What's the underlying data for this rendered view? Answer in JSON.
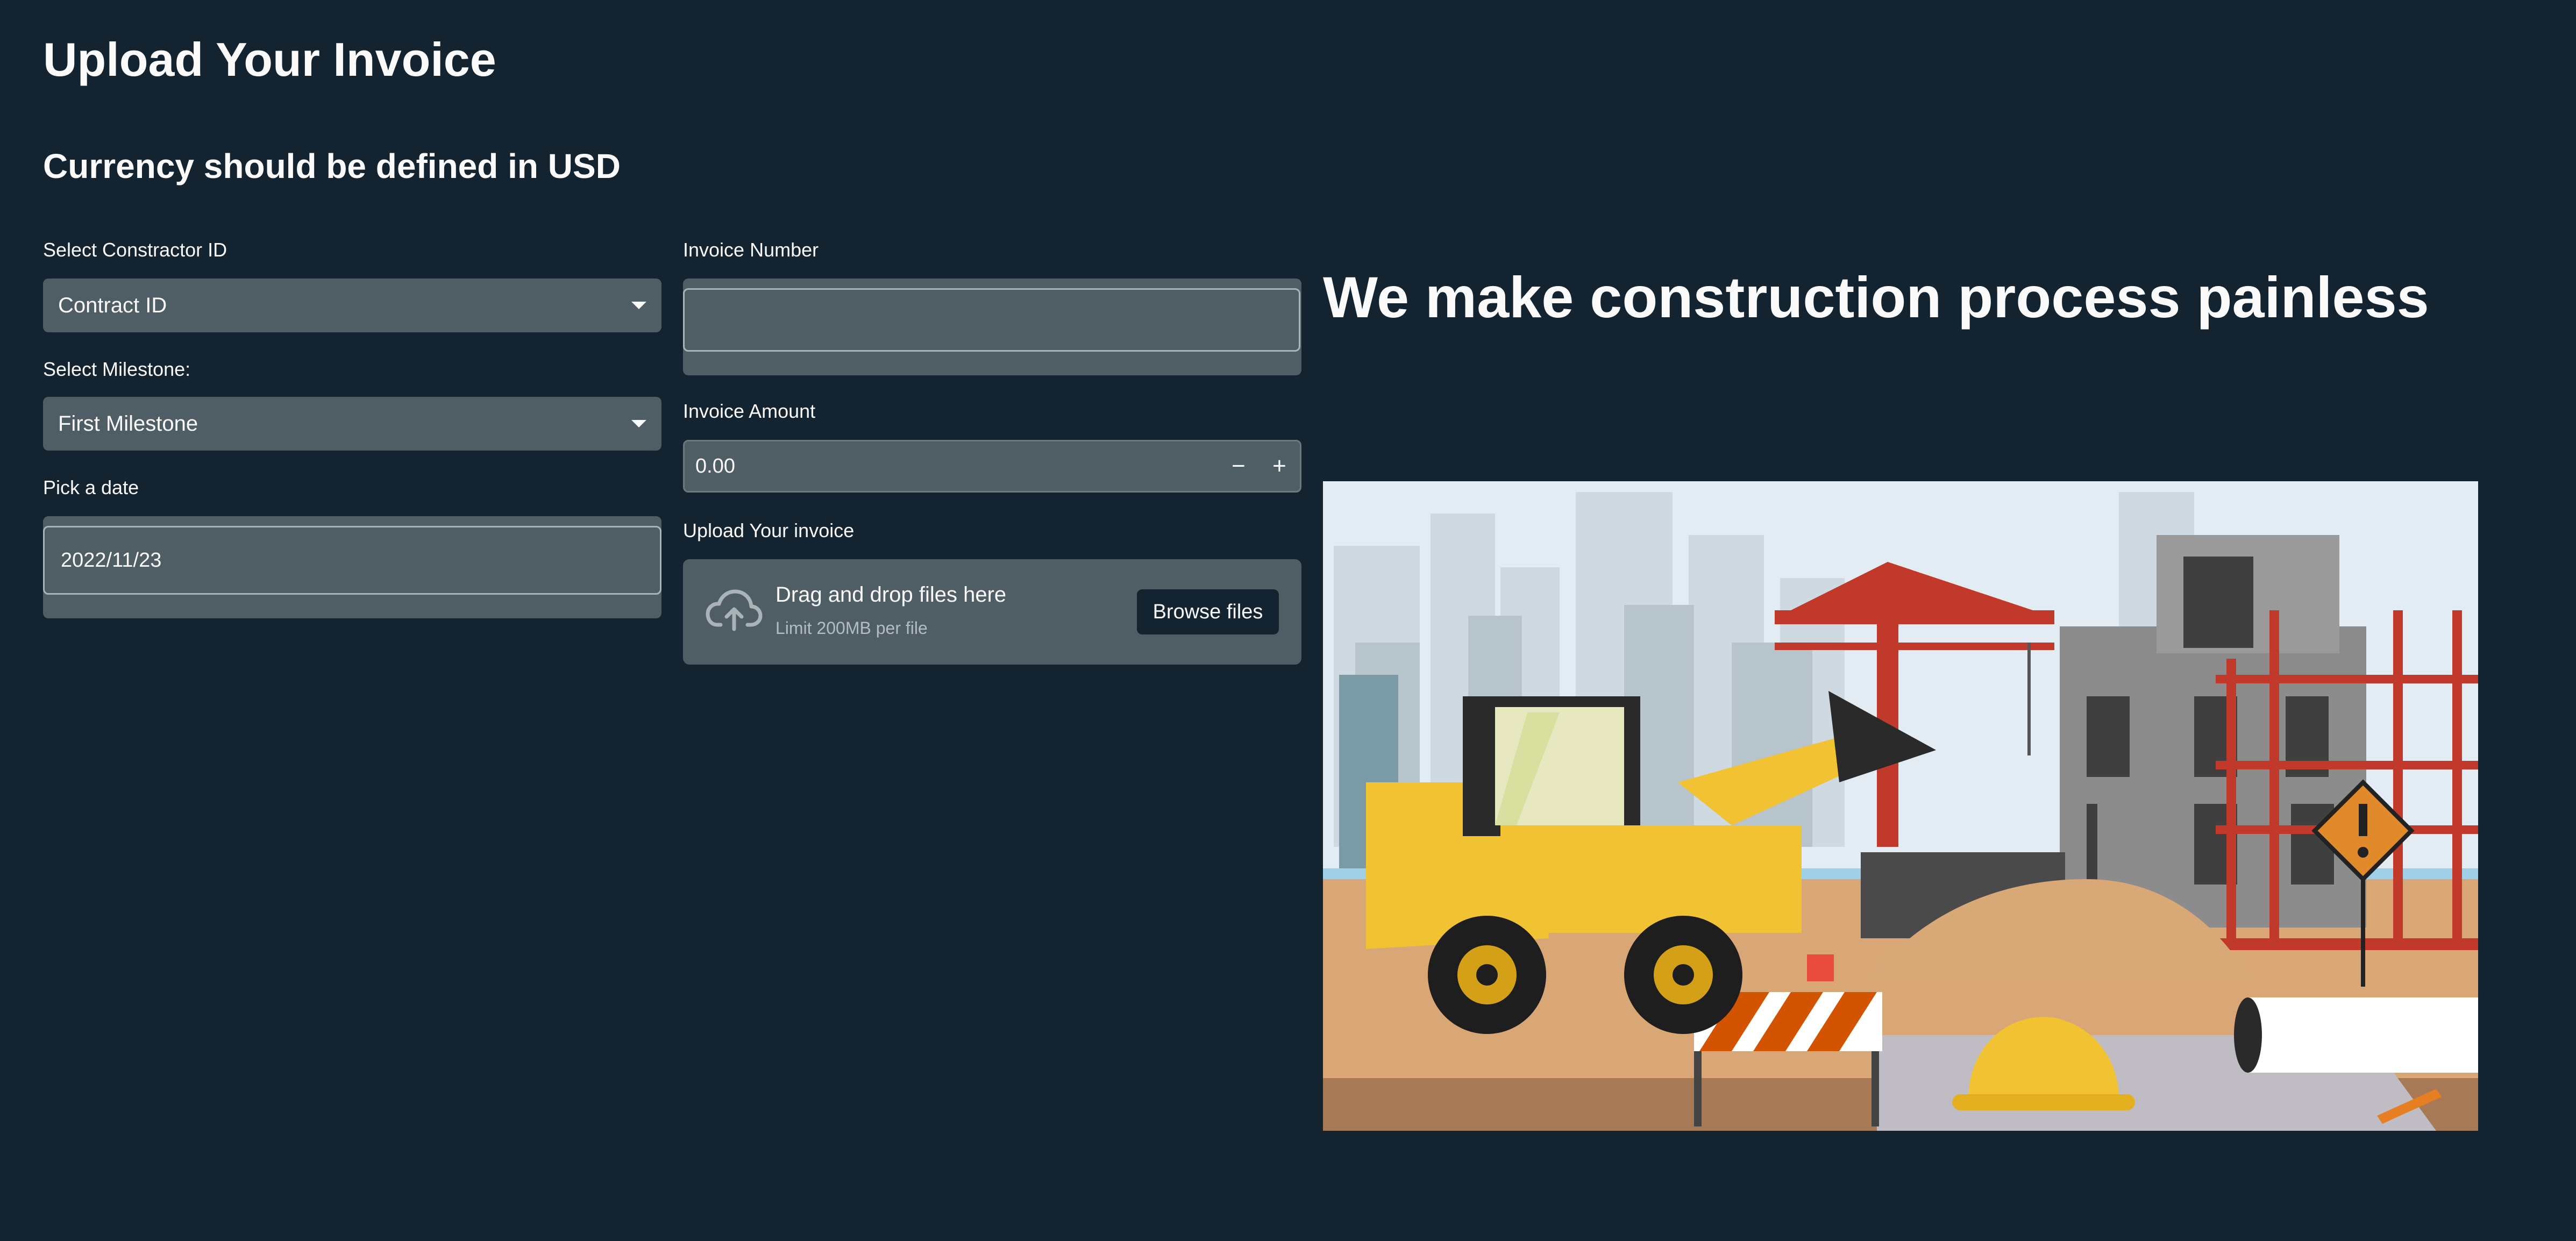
{
  "page": {
    "title": "Upload Your Invoice",
    "subtitle": "Currency should be defined in USD"
  },
  "form": {
    "contractor": {
      "label": "Select Constractor ID",
      "value": "Contract ID"
    },
    "milestone": {
      "label": "Select Milestone:",
      "value": "First Milestone"
    },
    "date": {
      "label": "Pick a date",
      "value": "2022/11/23"
    },
    "invoice_number": {
      "label": "Invoice Number",
      "value": ""
    },
    "invoice_amount": {
      "label": "Invoice Amount",
      "value": "0.00",
      "decrement": "−",
      "increment": "+"
    },
    "upload": {
      "label": "Upload Your invoice",
      "drag_text": "Drag and drop files here",
      "limit_text": "Limit 200MB per file",
      "browse_label": "Browse files"
    }
  },
  "hero": {
    "headline": "We make construction process painless",
    "image_icon": "construction-site-illustration"
  },
  "colors": {
    "background": "#13232f",
    "widget": "#4f5d64",
    "text": "#fafafa"
  }
}
